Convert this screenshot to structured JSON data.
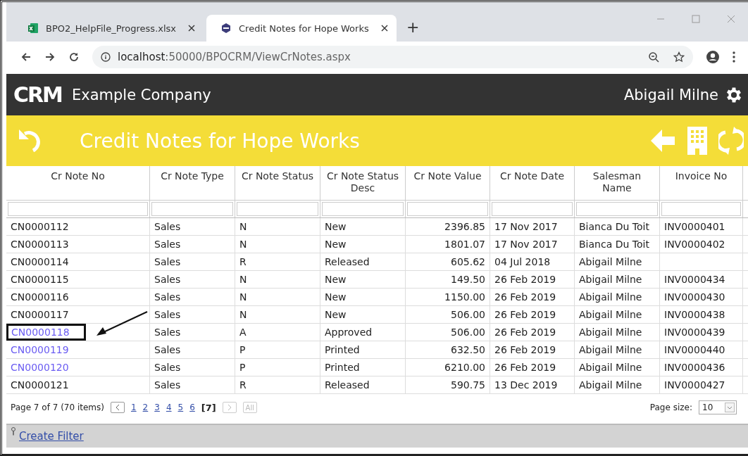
{
  "browser": {
    "tabs": [
      {
        "title": "BPO2_HelpFile_Progress.xlsx",
        "kind": "excel",
        "selected": false
      },
      {
        "title": "Credit Notes for Hope Works",
        "kind": "crm",
        "selected": true
      }
    ],
    "new_tab": "+",
    "address": {
      "host": "localhost",
      "path": ":50000/BPOCRM/ViewCrNotes.aspx"
    }
  },
  "header": {
    "logo": "CRM",
    "company": "Example Company",
    "user": "Abigail Milne"
  },
  "title_bar": {
    "title": "Credit Notes for Hope Works"
  },
  "table": {
    "columns": [
      {
        "label": "Cr Note No"
      },
      {
        "label": "Cr Note Type"
      },
      {
        "label": "Cr Note Status"
      },
      {
        "label": "Cr Note Status Desc"
      },
      {
        "label": "Cr Note Value"
      },
      {
        "label": "Cr Note Date"
      },
      {
        "label": "Salesman Name"
      },
      {
        "label": "Invoice No"
      }
    ],
    "rows": [
      {
        "link": false,
        "annotated": false,
        "cells": [
          "CN0000112",
          "Sales",
          "N",
          "New",
          "2396.85",
          "17 Nov 2017",
          "Bianca Du Toit",
          "INV0000401"
        ]
      },
      {
        "link": false,
        "annotated": false,
        "cells": [
          "CN0000113",
          "Sales",
          "N",
          "New",
          "1801.07",
          "17 Nov 2017",
          "Bianca Du Toit",
          "INV0000402"
        ]
      },
      {
        "link": false,
        "annotated": false,
        "cells": [
          "CN0000114",
          "Sales",
          "R",
          "Released",
          "605.62",
          "04 Jul 2018",
          "Abigail Milne",
          ""
        ]
      },
      {
        "link": false,
        "annotated": false,
        "cells": [
          "CN0000115",
          "Sales",
          "N",
          "New",
          "149.50",
          "26 Feb 2019",
          "Abigail Milne",
          "INV0000434"
        ]
      },
      {
        "link": false,
        "annotated": false,
        "cells": [
          "CN0000116",
          "Sales",
          "N",
          "New",
          "1150.00",
          "26 Feb 2019",
          "Abigail Milne",
          "INV0000430"
        ]
      },
      {
        "link": false,
        "annotated": false,
        "cells": [
          "CN0000117",
          "Sales",
          "N",
          "New",
          "506.00",
          "26 Feb 2019",
          "Abigail Milne",
          "INV0000438"
        ]
      },
      {
        "link": true,
        "annotated": true,
        "cells": [
          "CN0000118",
          "Sales",
          "A",
          "Approved",
          "506.00",
          "26 Feb 2019",
          "Abigail Milne",
          "INV0000439"
        ]
      },
      {
        "link": true,
        "annotated": false,
        "cells": [
          "CN0000119",
          "Sales",
          "P",
          "Printed",
          "632.50",
          "26 Feb 2019",
          "Abigail Milne",
          "INV0000440"
        ]
      },
      {
        "link": true,
        "annotated": false,
        "cells": [
          "CN0000120",
          "Sales",
          "P",
          "Printed",
          "6210.00",
          "26 Feb 2019",
          "Abigail Milne",
          "INV0000436"
        ]
      },
      {
        "link": false,
        "annotated": false,
        "cells": [
          "CN0000121",
          "Sales",
          "R",
          "Released",
          "590.75",
          "13 Dec 2019",
          "Abigail Milne",
          "INV0000427"
        ]
      }
    ]
  },
  "pager": {
    "summary": "Page 7 of 7 (70 items)",
    "prev_disabled": false,
    "next_disabled": true,
    "pages": [
      {
        "label": "1",
        "selected": false
      },
      {
        "label": "2",
        "selected": false
      },
      {
        "label": "3",
        "selected": false
      },
      {
        "label": "4",
        "selected": false
      },
      {
        "label": "5",
        "selected": false
      },
      {
        "label": "6",
        "selected": false
      },
      {
        "label": "[7]",
        "selected": true
      }
    ],
    "all": {
      "label": "All",
      "disabled": true
    },
    "page_size_label": "Page size:",
    "page_size": "10"
  },
  "filter_bar": {
    "link": "Create Filter"
  }
}
